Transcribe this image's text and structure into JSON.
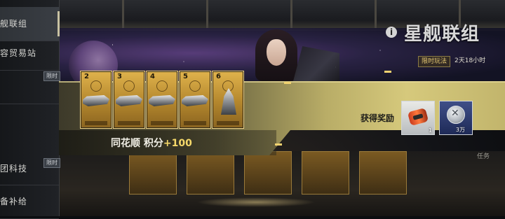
{
  "sidebar": {
    "items": [
      {
        "label": "舰联组",
        "active": true,
        "limited": false
      },
      {
        "label": "容贸易站",
        "active": false,
        "limited": false
      },
      {
        "label": "",
        "active": false,
        "limited": true
      },
      {
        "label": "团科技",
        "active": false,
        "limited": true
      },
      {
        "label": "备补给",
        "active": false,
        "limited": false
      }
    ],
    "limited_badge": "限时"
  },
  "header": {
    "title": "星舰联组",
    "info_icon": "i",
    "tag": "限时玩法",
    "countdown": "2天18小时"
  },
  "cards": [
    {
      "number": "2",
      "icon": "ship-icon"
    },
    {
      "number": "3",
      "icon": "ship-icon"
    },
    {
      "number": "4",
      "icon": "ship-icon"
    },
    {
      "number": "5",
      "icon": "ship-icon"
    },
    {
      "number": "6",
      "icon": "tower-icon"
    }
  ],
  "combo": {
    "label": "同花顺 积分",
    "points": "+100"
  },
  "rewards": {
    "label": "获得奖励",
    "items": [
      {
        "name": "canister-icon",
        "qty": "1"
      },
      {
        "name": "coin-icon",
        "qty": "3万"
      }
    ]
  },
  "right_hint": "任务"
}
